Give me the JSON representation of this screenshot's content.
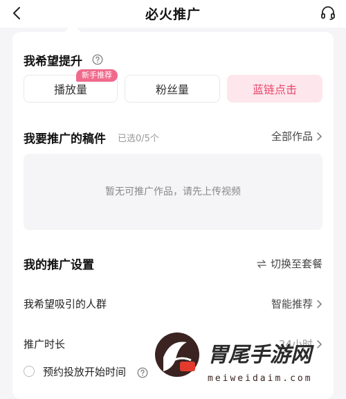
{
  "header": {
    "title": "必火推广"
  },
  "boost": {
    "title": "我希望提升",
    "badge": "新手推荐",
    "options": [
      {
        "label": "播放量",
        "selected": false
      },
      {
        "label": "粉丝量",
        "selected": false
      },
      {
        "label": "蓝链点击",
        "selected": true
      }
    ]
  },
  "works": {
    "title": "我要推广的稿件",
    "selected_count": "已选0/5个",
    "all_link": "全部作品",
    "empty_text": "暂无可推广作品，请先上传视频"
  },
  "settings": {
    "title": "我的推广设置",
    "switch_label": "切换至套餐",
    "audience_label": "我希望吸引的人群",
    "audience_value": "智能推荐",
    "duration_label": "推广时长",
    "duration_value": "24小时",
    "schedule_label": "预约投放开始时间"
  },
  "watermark": {
    "brand": "胃尾手游网",
    "url": "meiweidaim.com"
  },
  "colors": {
    "accent": "#e8456b",
    "selected_bg": "#fde7ec",
    "badge": "#f06a8c",
    "page_bg": "#f5f5f7"
  }
}
